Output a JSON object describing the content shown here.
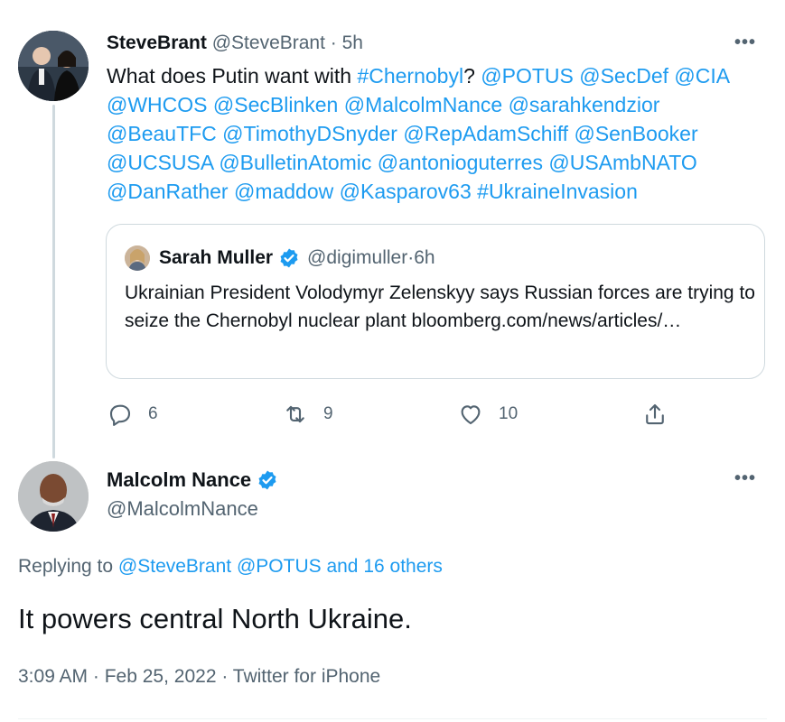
{
  "parent_tweet": {
    "display_name": "SteveBrant",
    "handle": "@SteveBrant",
    "separator": " · ",
    "time": "5h",
    "more_label": "•••",
    "text_segments": [
      {
        "text": "What does Putin want with ",
        "link": false
      },
      {
        "text": "#Chernobyl",
        "link": true
      },
      {
        "text": "? ",
        "link": false
      },
      {
        "text": "@POTUS",
        "link": true
      },
      {
        "text": " ",
        "link": false
      },
      {
        "text": "@SecDef",
        "link": true
      },
      {
        "text": " ",
        "link": false
      },
      {
        "text": "@CIA",
        "link": true
      },
      {
        "text": " ",
        "link": false
      },
      {
        "text": "@WHCOS",
        "link": true
      },
      {
        "text": " ",
        "link": false
      },
      {
        "text": "@SecBlinken",
        "link": true
      },
      {
        "text": " ",
        "link": false
      },
      {
        "text": "@MalcolmNance",
        "link": true
      },
      {
        "text": " ",
        "link": false
      },
      {
        "text": "@sarahkendzior",
        "link": true
      },
      {
        "text": " ",
        "link": false
      },
      {
        "text": "@BeauTFC",
        "link": true
      },
      {
        "text": " ",
        "link": false
      },
      {
        "text": "@TimothyDSnyder",
        "link": true
      },
      {
        "text": " ",
        "link": false
      },
      {
        "text": "@RepAdamSchiff",
        "link": true
      },
      {
        "text": " ",
        "link": false
      },
      {
        "text": "@SenBooker",
        "link": true
      },
      {
        "text": " ",
        "link": false
      },
      {
        "text": "@UCSUSA",
        "link": true
      },
      {
        "text": " ",
        "link": false
      },
      {
        "text": "@BulletinAtomic",
        "link": true
      },
      {
        "text": " ",
        "link": false
      },
      {
        "text": "@antonioguterres",
        "link": true
      },
      {
        "text": " ",
        "link": false
      },
      {
        "text": "@USAmbNATO",
        "link": true
      },
      {
        "text": " ",
        "link": false
      },
      {
        "text": "@DanRather",
        "link": true
      },
      {
        "text": " ",
        "link": false
      },
      {
        "text": "@maddow",
        "link": true
      },
      {
        "text": " ",
        "link": false
      },
      {
        "text": "@Kasparov63",
        "link": true
      },
      {
        "text": " ",
        "link": false
      },
      {
        "text": "#UkraineInvasion",
        "link": true
      }
    ],
    "quote": {
      "display_name": "Sarah Muller",
      "handle": "@digimuller",
      "separator": " · ",
      "time": "6h",
      "text": "Ukrainian President Volodymyr Zelenskyy says Russian forces are trying to seize the Chernobyl nuclear plant bloomberg.com/news/articles/…"
    },
    "actions": {
      "replies": "6",
      "retweets": "9",
      "likes": "10"
    }
  },
  "reply_tweet": {
    "display_name": "Malcolm Nance",
    "handle": "@MalcolmNance",
    "more_label": "•••",
    "replying_to_prefix": "Replying to ",
    "replying_to_links": "@SteveBrant @POTUS and 16 others",
    "text": "It powers central North Ukraine.",
    "time": "3:09 AM",
    "separator": " · ",
    "date": "Feb 25, 2022",
    "client": "Twitter for iPhone"
  },
  "colors": {
    "link": "#1d9bf0",
    "text": "#0f1419",
    "muted": "#536471",
    "border": "#cfd9de"
  },
  "icons": {
    "reply": "reply-icon",
    "retweet": "retweet-icon",
    "like": "heart-icon",
    "share": "share-icon",
    "verified": "verified-badge-icon",
    "more": "more-icon"
  }
}
